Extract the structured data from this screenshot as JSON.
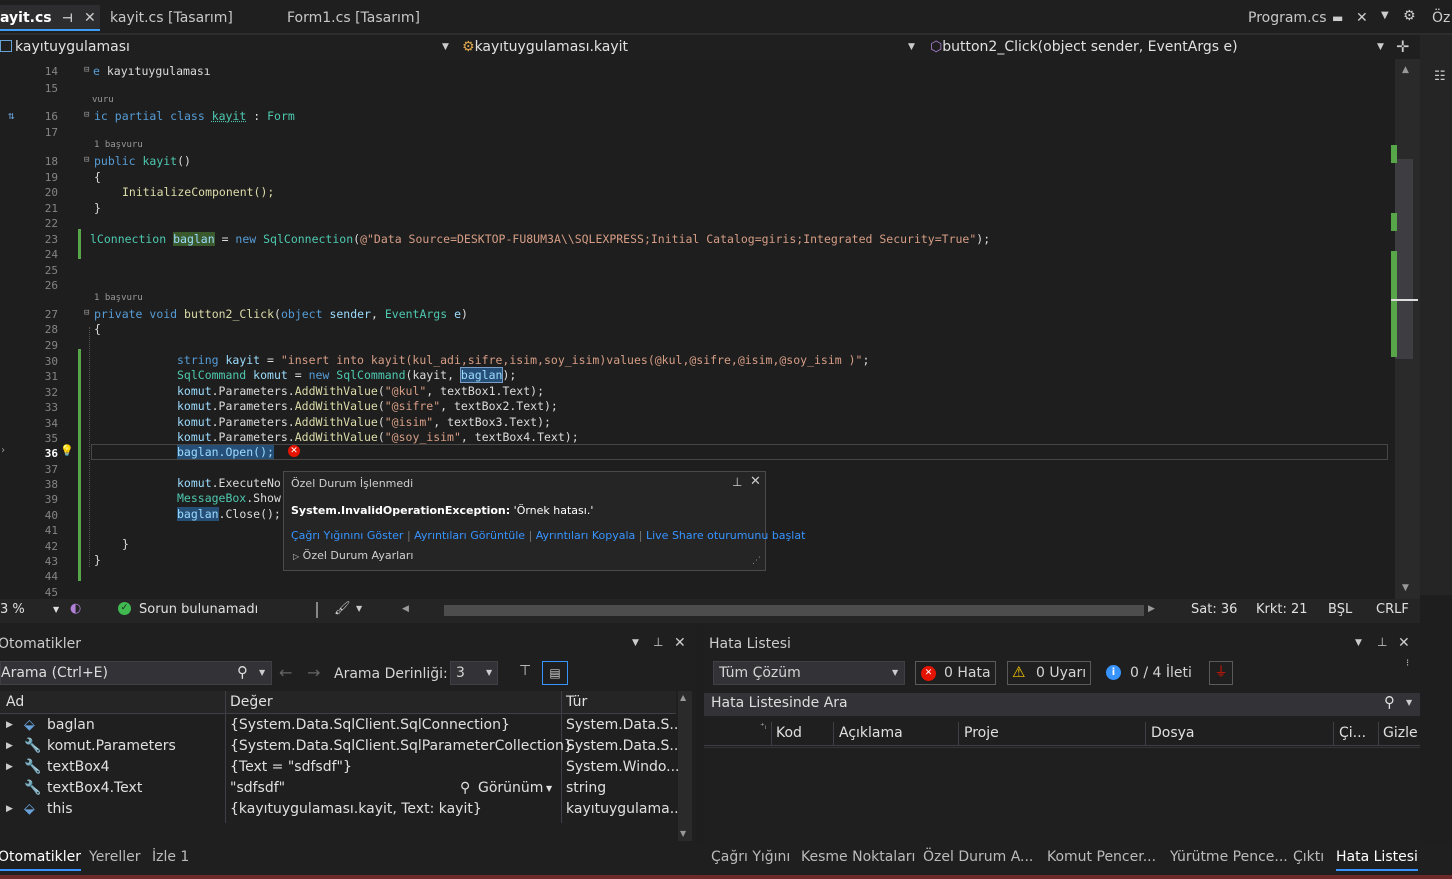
{
  "tabs": {
    "active": "ayit.cs",
    "t2": "kayit.cs [Tasarım]",
    "t3": "Form1.cs [Tasarım]",
    "right": "Program.cs",
    "edge": "Öz"
  },
  "nav": {
    "project": "kayıtuygulaması",
    "class": "kayıtuygulaması.kayit",
    "member": "button2_Click(object sender, EventArgs e)"
  },
  "lines": [
    "14",
    "15",
    "16",
    "17",
    "18",
    "19",
    "20",
    "21",
    "22",
    "23",
    "24",
    "25",
    "26",
    "27",
    "28",
    "29",
    "30",
    "31",
    "32",
    "33",
    "34",
    "35",
    "36",
    "37",
    "38",
    "39",
    "40",
    "41",
    "42",
    "43",
    "44",
    "45"
  ],
  "lens": {
    "l16": "vuru",
    "l18": "1 başvuru",
    "l27": "1 başvuru"
  },
  "code": {
    "l14_kw": "e",
    "l14_ns": " kayıtuygulaması",
    "l16_a": "ic partial class ",
    "l16_b": "kayit",
    "l16_c": " : ",
    "l16_d": "Form",
    "l18_a": "public ",
    "l18_b": "kayit",
    "l18_c": "()",
    "l19": "{",
    "l20": "InitializeComponent();",
    "l21": "}",
    "l23_a": "lConnection ",
    "l23_b": "baglan",
    "l23_c": " = ",
    "l23_d": "new ",
    "l23_e": "SqlConnection",
    "l23_f": "(",
    "l23_g": "@\"Data Source=DESKTOP-FU8UM3A\\\\SQLEXPRESS;Initial Catalog=giris;Integrated Security=True\"",
    "l23_h": ");",
    "l27_a": "private ",
    "l27_b": "void ",
    "l27_c": "button2_Click",
    "l27_d": "(",
    "l27_e": "object ",
    "l27_f": "sender",
    "l27_g": ", ",
    "l27_h": "EventArgs ",
    "l27_i": "e",
    "l27_j": ")",
    "l28": "{",
    "l30_a": "string ",
    "l30_b": "kayit",
    "l30_c": " = ",
    "l30_d": "\"insert into kayit(kul_adi,sifre,isim,soy_isim)values(@kul,@sifre,@isim,@soy_isim )\"",
    "l30_e": ";",
    "l31_a": "SqlCommand ",
    "l31_b": "komut",
    "l31_c": " = ",
    "l31_d": "new ",
    "l31_e": "SqlCommand",
    "l31_f": "(kayit, ",
    "l31_g": "baglan",
    "l31_h": ");",
    "l32_a": "komut",
    "l32_b": ".Parameters.",
    "l32_c": "AddWithValue",
    "l32_d": "(",
    "l32_e": "\"@kul\"",
    "l32_f": ", textBox1.Text);",
    "l33_e": "\"@sifre\"",
    "l33_f": ", textBox2.Text);",
    "l34_e": "\"@isim\"",
    "l34_f": ", textBox3.Text);",
    "l35_e": "\"@soy_isim\"",
    "l35_f": ", textBox4.Text);",
    "l36": "baglan.Open();",
    "l38_a": "komut",
    "l38_b": ".ExecuteNo",
    "l39_a": "MessageBox",
    "l39_b": ".Show",
    "l40_a": "baglan",
    "l40_b": ".Close();",
    "l42": "}",
    "l43": "}"
  },
  "exception": {
    "title": "Özel Durum İşlenmedi",
    "type": "System.InvalidOperationException:",
    "message": " 'Örnek hatası.'",
    "link1": "Çağrı Yığınını Göster",
    "link2": "Ayrıntıları Görüntüle",
    "link3": "Ayrıntıları Kopyala",
    "link4": "Live Share oturumunu başlat",
    "settings": "Özel Durum Ayarları"
  },
  "editor_status": {
    "zoom": "3 %",
    "issues": "Sorun bulunamadı",
    "line": "Sat: 36",
    "char": "Krkt: 21",
    "mode": "BŞL",
    "eol": "CRLF"
  },
  "autos": {
    "title": "Otomatikler",
    "search": "Arama (Ctrl+E)",
    "depth_label": "Arama Derinliği:",
    "depth_value": "3",
    "col_name": "Ad",
    "col_value": "Değer",
    "col_type": "Tür",
    "rows": [
      {
        "name": "baglan",
        "value": "{System.Data.SqlClient.SqlConnection}",
        "type": "System.Data.S..."
      },
      {
        "name": "komut.Parameters",
        "value": "{System.Data.SqlClient.SqlParameterCollection}",
        "type": "System.Data.S..."
      },
      {
        "name": "textBox4",
        "value": "{Text = \"sdfsdf\"}",
        "type": "System.Windo..."
      },
      {
        "name": "textBox4.Text",
        "value": "\"sdfsdf\"",
        "type": "string"
      },
      {
        "name": "this",
        "value": "{kayıtuygulaması.kayit, Text: kayit}",
        "type": "kayıtuygulama..."
      }
    ],
    "view_label": "Görünüm"
  },
  "errors": {
    "title": "Hata Listesi",
    "scope": "Tüm Çözüm",
    "errors": "0 Hata",
    "warnings": "0 Uyarı",
    "messages": "0 / 4 İleti",
    "search": "Hata Listesinde Ara",
    "col_code": "Kod",
    "col_desc": "Açıklama",
    "col_project": "Proje",
    "col_file": "Dosya",
    "col_line": "Çi...",
    "col_hide": "Gizle"
  },
  "bottom_tabs_left": [
    "Otomatikler",
    "Yereller",
    "İzle 1"
  ],
  "bottom_tabs_right": [
    "Çağrı Yığını",
    "Kesme Noktaları",
    "Özel Durum A...",
    "Komut Pencer...",
    "Yürütme Pence...",
    "Çıktı",
    "Hata Listesi"
  ]
}
